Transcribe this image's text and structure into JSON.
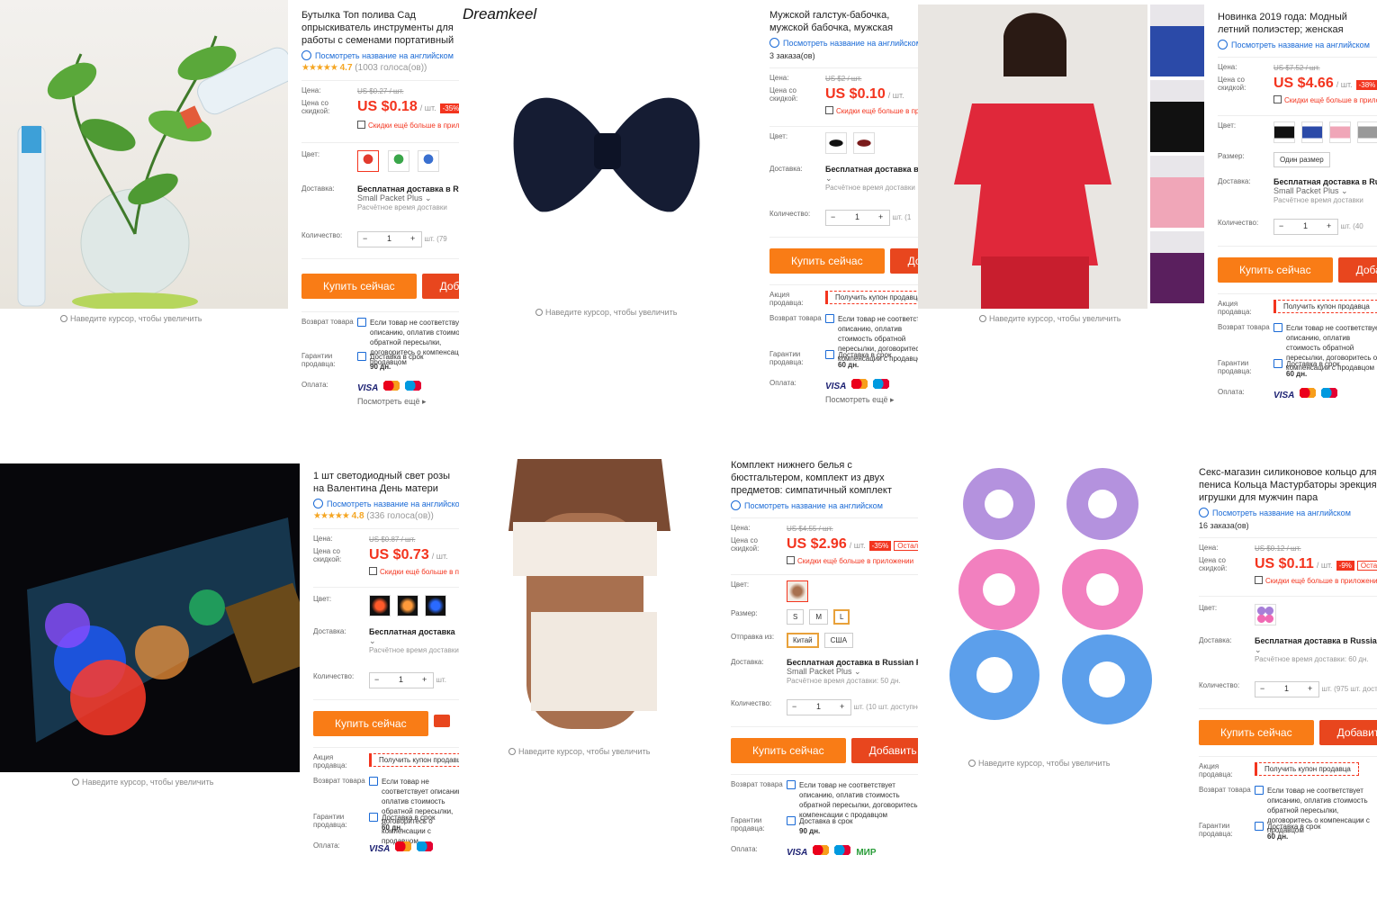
{
  "common": {
    "zoom_hint": "Наведите курсор, чтобы увеличить",
    "english_link": "Посмотреть название на английском",
    "price_label": "Цена:",
    "discount_label": "Цена со скидкой:",
    "per_unit": "/ шт.",
    "app_deal": "Скидки ещё больше в приложении",
    "color_label": "Цвет:",
    "size_label": "Размер:",
    "shipfrom_label": "Отправка из:",
    "delivery_label": "Доставка:",
    "qty_label": "Количество:",
    "buy_now": "Купить сейчас",
    "add_to_cart": "Добавить",
    "promo_label": "Акция продавца:",
    "coupon": "Получить купон продавца",
    "return_label": "Возврат товара",
    "return_text": "Если товар не соответствует описанию, оплатив стоимость обратной пересылки, договоритесь о компенсации с продавцом",
    "guarantee_label": "Гарантии продавца:",
    "guarantee_text": "Доставка в срок",
    "payment_label": "Оплата:",
    "see_more": "Посмотреть ещё",
    "units": "шт.",
    "visa": "VISA",
    "mir": "МИР"
  },
  "p1": {
    "title": "Бутылка Топ полива Сад опрыскиватель инструменты для работы с семенами портативный бытовой увлажнитель",
    "rating": "4.7",
    "votes": "(1003 голоса(ов))",
    "old_price": "US $0.27 / шт.",
    "price": "US $0.18",
    "discount": "-35%",
    "delivery": "Бесплатная доставка в Russian Federation",
    "delivery_method": "Small Packet Plus",
    "delivery_time": "Расчётное время доставки",
    "qty": "1",
    "stock": "шт. (79",
    "days": "90 дн."
  },
  "p2": {
    "brand": "Dreamkeel"
  },
  "p3": {
    "title": "Мужской галстук-бабочка, мужской бабочка, мужская рубашка",
    "orders": "3 заказа(ов)",
    "old_price": "US $2 / шт.",
    "price": "US $0.10",
    "delivery": "Бесплатная доставка в",
    "delivery_time": "Расчётное время доставки",
    "qty": "1",
    "stock": "шт. (1",
    "days": "60 дн."
  },
  "p4": {
    "title": "Новинка 2019 года: Модный летний полиэстер; женская пижама с коротким рукавом",
    "old_price": "US $7.52 / шт.",
    "price": "US $4.66",
    "discount": "-38%",
    "size": "Один размер",
    "delivery": "Бесплатная доставка в Russian",
    "delivery_method": "Small Packet Plus",
    "delivery_time": "Расчётное время доставки",
    "qty": "1",
    "stock": "шт. (40",
    "days": "60 дн."
  },
  "p5": {
    "title": "1 шт светодиодный свет розы на Валентина День матери Хэллоуин",
    "rating": "4.8",
    "votes": "(336 голоса(ов))",
    "old_price": "US $0.87 / шт.",
    "price": "US $0.73",
    "delivery": "Бесплатная доставка",
    "delivery_time": "Расчётное время доставки",
    "qty": "1",
    "stock": "шт.",
    "days": "60 дн."
  },
  "p6": {
    "title": "Комплект нижнего белья с бюстгальтером, комплект из двух предметов: симпатичный комплект нижнего белья; Bielizna damcka",
    "old_price": "US $4.55 / шт.",
    "price": "US $2.96",
    "discount": "-35%",
    "discount2": "Осталось",
    "sizes": [
      "S",
      "M",
      "L"
    ],
    "ship_from": [
      "Китай",
      "США"
    ],
    "delivery": "Бесплатная доставка в Russian Federation",
    "delivery_method": "Small Packet Plus",
    "delivery_time": "Расчётное время доставки: 50 дн.",
    "qty": "1",
    "stock": "шт. (10 шт. доступно)",
    "days": "90 дн."
  },
  "p7": {
    "title": "Секс-магазин силиконовое кольцо для пениса Кольца Мастурбаторы эрекция игрушки для мужчин пара",
    "orders": "16 заказа(ов)",
    "old_price": "US $0.12 / шт.",
    "price": "US $0.11",
    "discount": "-9%",
    "discount2": "Осталось",
    "delivery": "Бесплатная доставка в Russian Federation",
    "delivery_time": "Расчётное время доставки: 60 дн.",
    "qty": "1",
    "stock": "шт. (975 шт. доступно)",
    "days": "60 дн."
  }
}
